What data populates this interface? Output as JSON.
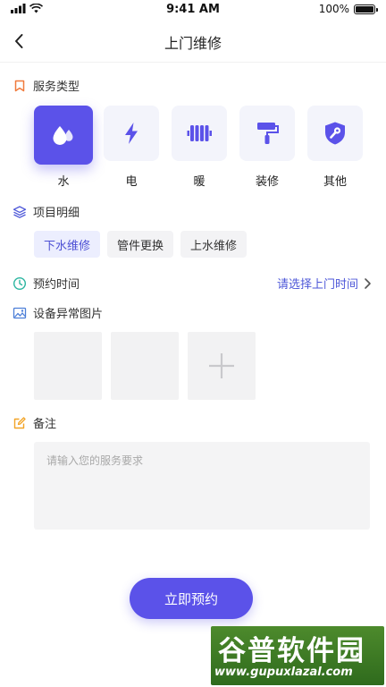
{
  "status_bar": {
    "time": "9:41 AM",
    "battery": "100%"
  },
  "nav": {
    "title": "上门维修"
  },
  "sections": {
    "service_type": "服务类型",
    "project_detail": "项目明细",
    "appointment_time": "预约时间",
    "device_photos": "设备异常图片",
    "remark": "备注"
  },
  "services": [
    {
      "label": "水",
      "icon": "water-drop-icon",
      "selected": true
    },
    {
      "label": "电",
      "icon": "lightning-icon",
      "selected": false
    },
    {
      "label": "暖",
      "icon": "radiator-icon",
      "selected": false
    },
    {
      "label": "装修",
      "icon": "paint-roller-icon",
      "selected": false
    },
    {
      "label": "其他",
      "icon": "wrench-shield-icon",
      "selected": false
    }
  ],
  "project_items": [
    {
      "label": "下水维修",
      "selected": true
    },
    {
      "label": "管件更换",
      "selected": false
    },
    {
      "label": "上水维修",
      "selected": false
    }
  ],
  "appointment": {
    "link_text": "请选择上门时间"
  },
  "remark": {
    "placeholder": "请输入您的服务要求",
    "value": ""
  },
  "submit": {
    "label": "立即预约"
  },
  "watermark": {
    "top": "谷普软件园",
    "bottom": "www.gupuxlazal.com"
  },
  "colors": {
    "accent": "#5b52e9",
    "link": "#4d57d8",
    "chip_active_bg": "#eceefe"
  }
}
